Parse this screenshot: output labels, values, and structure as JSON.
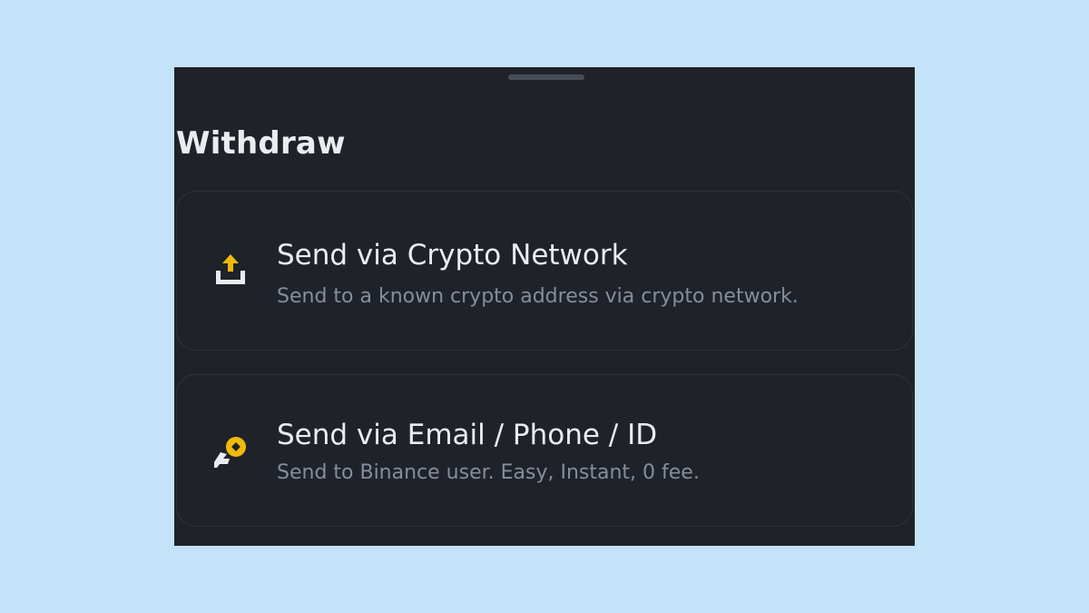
{
  "sheet": {
    "title": "Withdraw"
  },
  "options": [
    {
      "title": "Send via Crypto Network",
      "subtitle": "Send to a known crypto address via crypto network.",
      "icon": "upload-tray-icon"
    },
    {
      "title": "Send via Email / Phone / ID",
      "subtitle": "Send to Binance user. Easy, Instant, 0 fee.",
      "icon": "send-coin-icon"
    }
  ],
  "colors": {
    "background": "#c4e3f9",
    "sheet": "#1f2329",
    "accent": "#f0b90b",
    "text_primary": "#eaecef",
    "text_secondary": "#848e9c",
    "border": "#2e333b"
  }
}
